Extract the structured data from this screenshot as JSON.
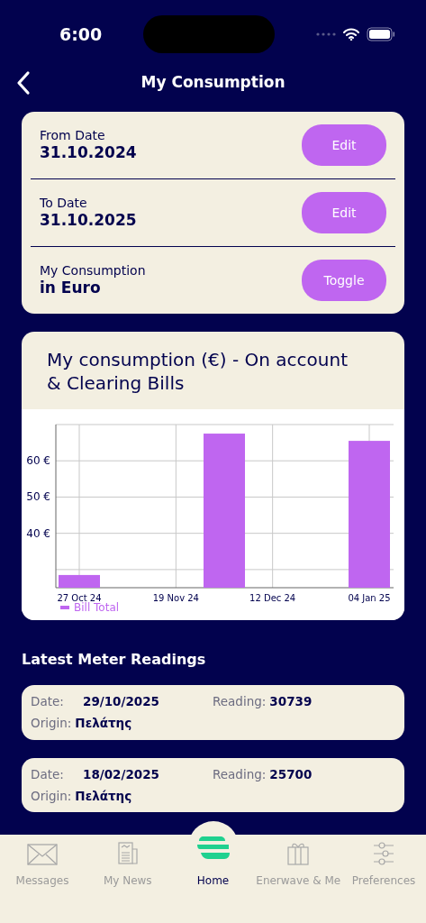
{
  "status_bar": {
    "time": "6:00"
  },
  "header": {
    "title": "My Consumption"
  },
  "settings": [
    {
      "label": "From Date",
      "value": "31.10.2024",
      "action": "Edit"
    },
    {
      "label": "To Date",
      "value": "31.10.2025",
      "action": "Edit"
    },
    {
      "label": "My Consumption",
      "value": "in Euro",
      "action": "Toggle"
    }
  ],
  "chart_card": {
    "title": "My consumption (€) - On account & Clearing Bills",
    "chart_data": {
      "type": "bar",
      "categories": [
        "27 Oct 24",
        null,
        "19 Nov 24",
        null,
        "12 Dec 24",
        null,
        "04 Jan 25"
      ],
      "series": [
        {
          "name": "Bill Total",
          "color": "#bf66f0",
          "values": [
            28.5,
            null,
            null,
            67.5,
            null,
            null,
            65.5
          ]
        }
      ],
      "ylim": [
        25,
        70
      ],
      "grid": true,
      "yticks": [
        {
          "value": 40,
          "label": "40 €"
        },
        {
          "value": 50,
          "label": "50 €"
        },
        {
          "value": 60,
          "label": "60 €"
        }
      ]
    }
  },
  "readings_title": "Latest Meter Readings",
  "readings": [
    {
      "date_label": "Date:",
      "date": "29/10/2025",
      "reading_label": "Reading:",
      "reading": "30739",
      "origin_label": "Origin:",
      "origin": "Πελάτης"
    },
    {
      "date_label": "Date:",
      "date": "18/02/2025",
      "reading_label": "Reading:",
      "reading": "25700",
      "origin_label": "Origin:",
      "origin": "Πελάτης"
    }
  ],
  "tabs": [
    {
      "label": "Messages",
      "kind": "mail",
      "selected": false
    },
    {
      "label": "My News",
      "kind": "news",
      "selected": false
    },
    {
      "label": "Home",
      "kind": "logo",
      "selected": true
    },
    {
      "label": "Enerwave & Me",
      "kind": "gift",
      "selected": false
    },
    {
      "label": "Preferences",
      "kind": "sliders",
      "selected": false
    }
  ]
}
